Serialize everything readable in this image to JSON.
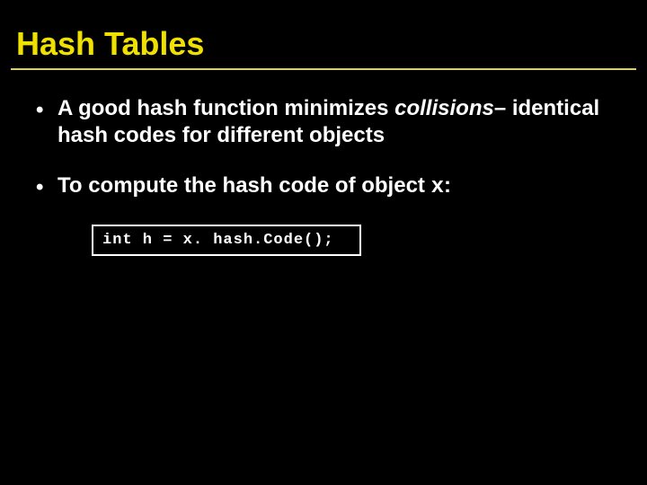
{
  "title": "Hash Tables",
  "bullets": {
    "b1": {
      "dot": "•",
      "pre": "A good hash function minimizes ",
      "em": "collisions",
      "post": "– identical hash codes for different objects"
    },
    "b2": {
      "dot": "•",
      "pre": "To compute the hash code of object ",
      "mono": "x",
      "post": ":"
    }
  },
  "code": "int h = x. hash.Code();"
}
